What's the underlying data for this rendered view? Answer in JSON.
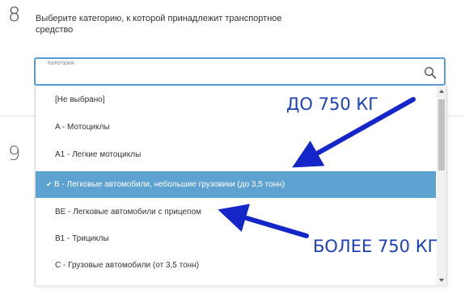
{
  "question8": {
    "number": "8",
    "text": "Выберите категорию, к которой принадлежит транспортное средство"
  },
  "question9": {
    "number": "9"
  },
  "select": {
    "label": "Категория",
    "search_icon": "search-icon"
  },
  "dropdown": {
    "options": [
      {
        "label": "[Не выбрано]",
        "selected": false
      },
      {
        "label": "A - Мотоциклы",
        "selected": false
      },
      {
        "label": "A1 - Легкие мотоциклы",
        "selected": false
      },
      {
        "label": "B - Легковые автомобили, небольшие грузовики (до 3,5 тонн)",
        "selected": true
      },
      {
        "label": "BE - Легковые автомобили с прицепом",
        "selected": false
      },
      {
        "label": "B1 - Трициклы",
        "selected": false
      },
      {
        "label": "C - Грузовые автомобили (от 3,5 тонн)",
        "selected": false
      }
    ],
    "check_mark": "✔",
    "selected_color": "#5ea2d2"
  },
  "annotations": {
    "top": "ДО 750 КГ",
    "bottom": "БОЛЕЕ 750 КГ",
    "color": "#1d3fb8"
  }
}
